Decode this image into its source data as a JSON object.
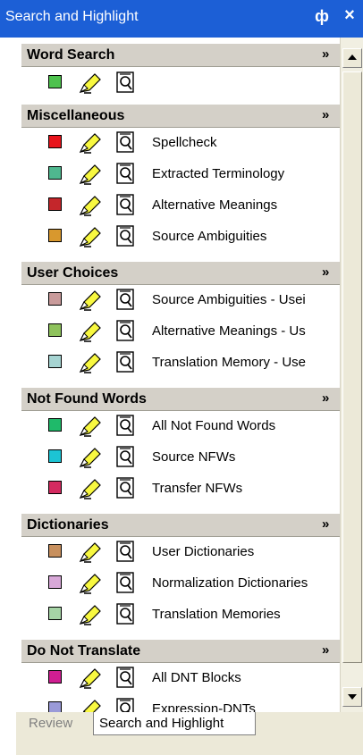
{
  "window": {
    "title": "Search and Highlight",
    "pin_glyph": "ф",
    "close_glyph": "×"
  },
  "sections": [
    {
      "title": "Word Search",
      "items": []
    },
    {
      "title": "Miscellaneous",
      "items": [
        {
          "label": "Spellcheck",
          "color": "#e8141c"
        },
        {
          "label": "Extracted Terminology",
          "color": "#4fb88f"
        },
        {
          "label": "Alternative Meanings",
          "color": "#c4262b"
        },
        {
          "label": "Source Ambiguities",
          "color": "#d8982e"
        }
      ]
    },
    {
      "title": "User Choices",
      "items": [
        {
          "label": "Source Ambiguities - Usei",
          "color": "#c99b9b"
        },
        {
          "label": "Alternative Meanings - Us",
          "color": "#8ec25c"
        },
        {
          "label": "Translation Memory - Use",
          "color": "#a6d4d2"
        }
      ]
    },
    {
      "title": "Not Found Words",
      "items": [
        {
          "label": "All Not Found Words",
          "color": "#1fba6a"
        },
        {
          "label": "Source NFWs",
          "color": "#1cc4d4"
        },
        {
          "label": "Transfer NFWs",
          "color": "#d42a60"
        }
      ]
    },
    {
      "title": "Dictionaries",
      "items": [
        {
          "label": "User Dictionaries",
          "color": "#c8905e"
        },
        {
          "label": "Normalization Dictionaries",
          "color": "#d8a8d8"
        },
        {
          "label": "Translation Memories",
          "color": "#a6d4a6"
        }
      ]
    },
    {
      "title": "Do Not Translate",
      "items": [
        {
          "label": "All DNT Blocks",
          "color": "#d01e92"
        },
        {
          "label": "Expression-DNTs",
          "color": "#9a9ad8"
        }
      ]
    }
  ],
  "word_search": {
    "color": "#4ec24e",
    "value": ""
  },
  "chevron": "»",
  "tabs": [
    {
      "label": "Review",
      "active": false
    },
    {
      "label": "Search and Highlight",
      "active": true
    }
  ]
}
